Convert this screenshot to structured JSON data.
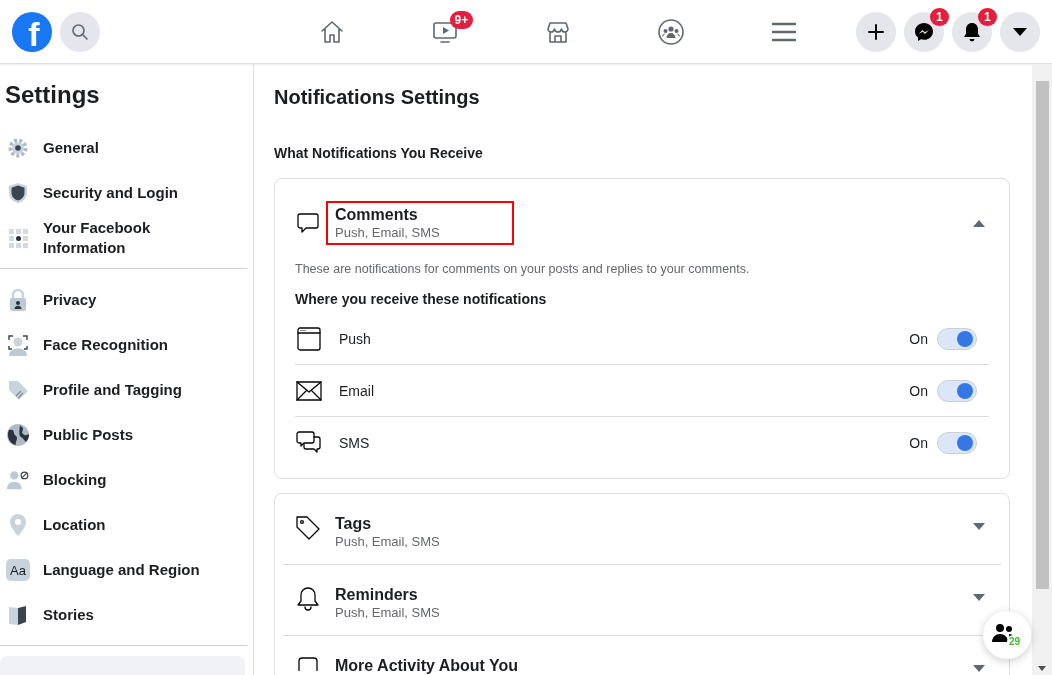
{
  "topbar": {
    "logo": "f",
    "video_badge": "9+",
    "messenger_badge": "1",
    "notifications_badge": "1"
  },
  "sidebar": {
    "title": "Settings",
    "groups": [
      {
        "items": [
          {
            "label": "General"
          },
          {
            "label": "Security and Login"
          },
          {
            "label": "Your Facebook Information"
          }
        ]
      },
      {
        "items": [
          {
            "label": "Privacy"
          },
          {
            "label": "Face Recognition"
          },
          {
            "label": "Profile and Tagging"
          },
          {
            "label": "Public Posts"
          },
          {
            "label": "Blocking"
          },
          {
            "label": "Location"
          },
          {
            "label": "Language and Region",
            "icon_text": "Aa"
          },
          {
            "label": "Stories"
          }
        ]
      }
    ]
  },
  "main": {
    "title": "Notifications Settings",
    "section_title": "What Notifications You Receive",
    "cards": [
      {
        "categories": [
          {
            "title": "Comments",
            "subtitle": "Push, Email, SMS",
            "expanded": true,
            "highlighted": true,
            "description": "These are notifications for comments on your posts and replies to your comments.",
            "channels_heading": "Where you receive these notifications",
            "channels": [
              {
                "label": "Push",
                "state_text": "On",
                "on": true
              },
              {
                "label": "Email",
                "state_text": "On",
                "on": true
              },
              {
                "label": "SMS",
                "state_text": "On",
                "on": true
              }
            ]
          }
        ]
      },
      {
        "categories": [
          {
            "title": "Tags",
            "subtitle": "Push, Email, SMS",
            "expanded": false,
            "highlighted": false
          },
          {
            "title": "Reminders",
            "subtitle": "Push, Email, SMS",
            "expanded": false,
            "highlighted": false
          },
          {
            "title": "More Activity About You",
            "expanded": false,
            "highlighted": false
          }
        ]
      }
    ]
  },
  "contacts_button": {
    "count": "29"
  }
}
